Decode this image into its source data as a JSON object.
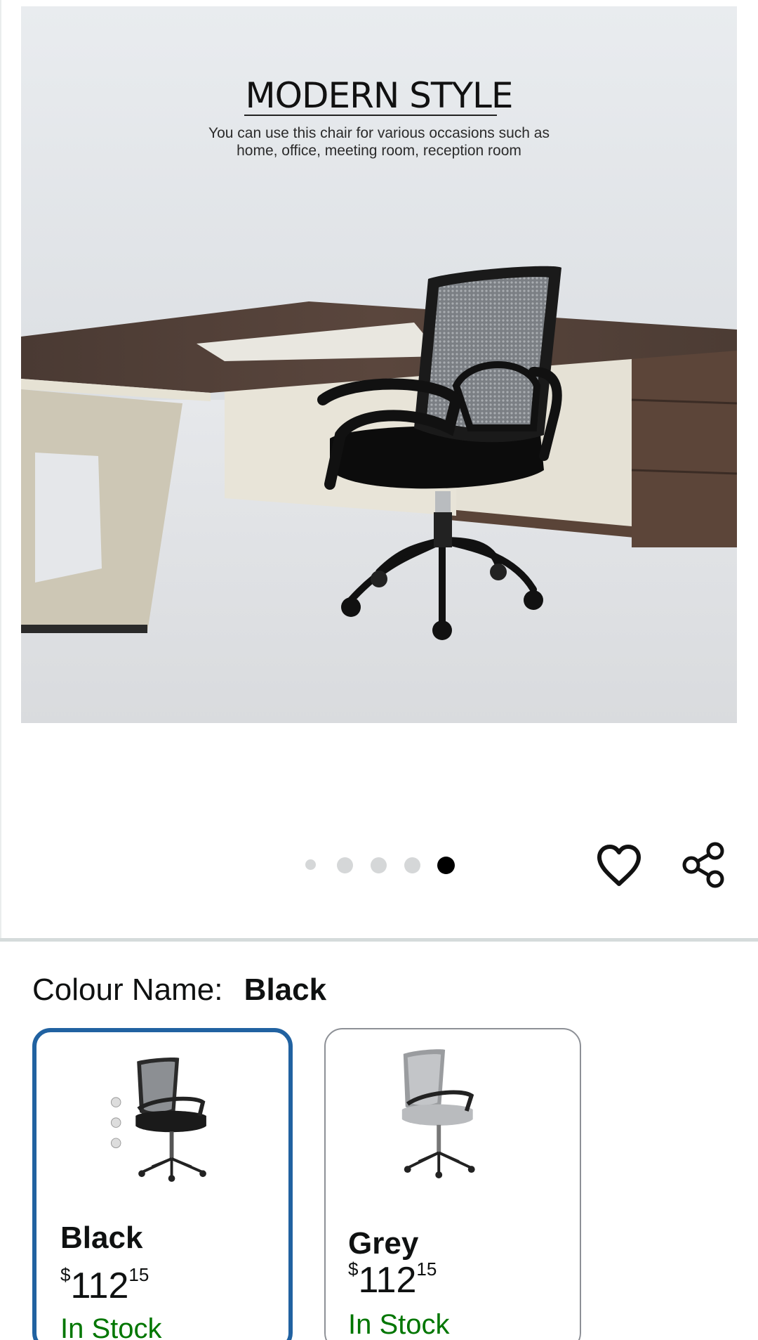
{
  "product_image": {
    "headline": "MODERN STYLE",
    "subtext_line1": "You can use this chair for various occasions such as",
    "subtext_line2": "home, office, meeting room, reception room"
  },
  "carousel": {
    "total_images": 5,
    "active_index": 5
  },
  "actions": {
    "wishlist_icon": "heart-icon",
    "share_icon": "share-icon"
  },
  "colour": {
    "label": "Colour Name:",
    "selected": "Black",
    "options": [
      {
        "name": "Black",
        "currency": "$",
        "price_whole": "112",
        "price_fraction": "15",
        "availability": "In Stock",
        "selected": true
      },
      {
        "name": "Grey",
        "currency": "$",
        "price_whole": "112",
        "price_fraction": "15",
        "availability": "In Stock",
        "selected": false
      }
    ]
  },
  "colors": {
    "selected_border": "#2162a1",
    "in_stock_text": "#007600",
    "divider": "#d5dbdb",
    "dot_inactive": "#d5d7d8",
    "dot_active": "#000000"
  }
}
